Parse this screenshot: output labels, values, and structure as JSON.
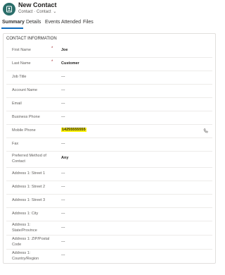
{
  "header": {
    "title": "New Contact",
    "subtitle": "Contact · Contact",
    "chevron": "⌄"
  },
  "tabs": [
    "Summary",
    "Details",
    "Events Attended",
    "Files"
  ],
  "section": {
    "title": "CONTACT INFORMATION"
  },
  "fields": [
    {
      "label": "First Name",
      "value": "Joe",
      "required": "*"
    },
    {
      "label": "Last Name",
      "value": "Customer",
      "required": "*"
    },
    {
      "label": "Job Title",
      "value": "---"
    },
    {
      "label": "Account Name",
      "value": "---"
    },
    {
      "label": "Email",
      "value": "---"
    },
    {
      "label": "Business Phone",
      "value": "---"
    },
    {
      "label": "Mobile Phone",
      "value": "14255555555"
    },
    {
      "label": "Fax",
      "value": "---"
    },
    {
      "label": "Preferred Method of Contact",
      "value": "Any"
    },
    {
      "label": "Address 1: Street 1",
      "value": "---"
    },
    {
      "label": "Address 1: Street 2",
      "value": "---"
    },
    {
      "label": "Address 1: Street 3",
      "value": "---"
    },
    {
      "label": "Address 1: City",
      "value": "---"
    },
    {
      "label": "Address 1: State/Province",
      "value": "---"
    },
    {
      "label": "Address 1: ZIP/Postal Code",
      "value": "---"
    },
    {
      "label": "Address 1: Country/Region",
      "value": "---"
    }
  ],
  "colors": {
    "accent": "#0f6cbd",
    "avatar": "#2b6e6a",
    "highlight": "#fff100",
    "required": "#a4262c"
  },
  "icons": {
    "avatar": "contact-icon",
    "mobile": "phone-icon"
  }
}
